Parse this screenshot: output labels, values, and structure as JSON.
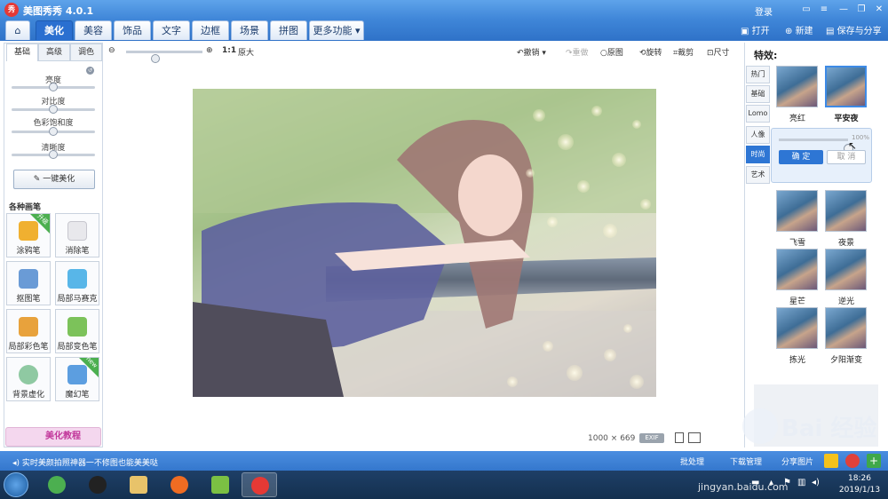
{
  "app": {
    "title": "美图秀秀 4.0.1",
    "logo": "秀",
    "login": "登录"
  },
  "nav": {
    "tabs": [
      {
        "label": "美化"
      },
      {
        "label": "美容"
      },
      {
        "label": "饰品"
      },
      {
        "label": "文字"
      },
      {
        "label": "边框"
      },
      {
        "label": "场景"
      },
      {
        "label": "拼图"
      },
      {
        "label": "更多功能"
      }
    ],
    "open_label": "打开",
    "new_label": "新建",
    "save_label": "保存与分享"
  },
  "left": {
    "tabs": [
      "基础",
      "高级",
      "调色"
    ],
    "sliders": [
      {
        "label": "亮度",
        "value": 0.5
      },
      {
        "label": "对比度",
        "value": 0.5
      },
      {
        "label": "色彩饱和度",
        "value": 0.5
      },
      {
        "label": "清晰度",
        "value": 0.5
      }
    ],
    "one_key": "一键美化",
    "section_title": "各种画笔",
    "tools": [
      {
        "label": "涂鸦笔",
        "badge": "升级"
      },
      {
        "label": "消除笔",
        "badge": ""
      },
      {
        "label": "抠图笔",
        "badge": ""
      },
      {
        "label": "局部马赛克",
        "badge": ""
      },
      {
        "label": "局部彩色笔",
        "badge": ""
      },
      {
        "label": "局部变色笔",
        "badge": ""
      },
      {
        "label": "背景虚化",
        "badge": ""
      },
      {
        "label": "魔幻笔",
        "badge": "new"
      }
    ],
    "tutorial": "美化教程"
  },
  "toolbar": {
    "ratio": "1:1",
    "original_size": "原大",
    "undo": "撤销",
    "redo": "重做",
    "original": "原图",
    "rotate": "旋转",
    "crop": "裁剪",
    "resize": "尺寸",
    "zoom": 0.1
  },
  "canvas": {
    "width": "1000",
    "times": "×",
    "height": "669",
    "exif": "EXIF"
  },
  "right": {
    "title": "特效:",
    "categories": [
      "热门",
      "基础",
      "Lomo",
      "人像",
      "时尚",
      "艺术"
    ],
    "active_category": "时尚",
    "top_effects": [
      {
        "label": "亮红",
        "selected": false
      },
      {
        "label": "平安夜",
        "selected": true
      }
    ],
    "strength": "100%",
    "ok": "确 定",
    "cancel": "取 消",
    "effects": [
      {
        "label": "飞雪"
      },
      {
        "label": "夜景"
      },
      {
        "label": "星芒"
      },
      {
        "label": "逆光"
      },
      {
        "label": "拣光"
      },
      {
        "label": "夕阳渐变"
      }
    ]
  },
  "status": {
    "text": "实时美颜拍照神器一不修图也能美美哒",
    "batch": "批处理",
    "download": "下载管理",
    "share": "分享图片"
  },
  "clock": {
    "time": "18:26",
    "date": "2019/1/13"
  },
  "watermark": {
    "text": "Bai 经验",
    "url": "jingyan.baidu.com"
  }
}
